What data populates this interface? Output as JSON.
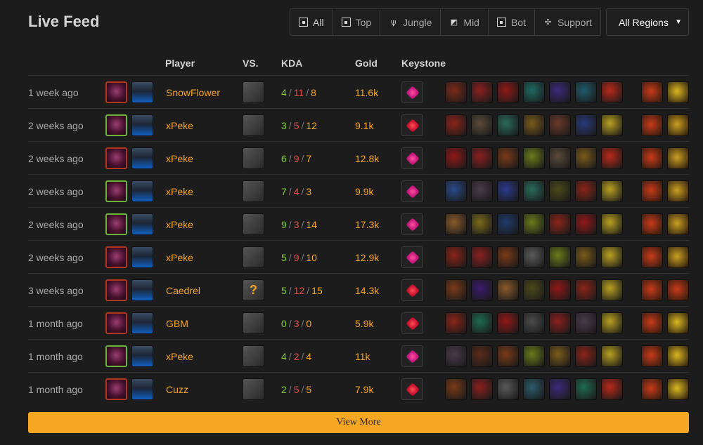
{
  "header": {
    "title": "Live Feed"
  },
  "filters": [
    {
      "label": "All",
      "icon": "all-role-icon",
      "glyph": ""
    },
    {
      "label": "Top",
      "icon": "top-role-icon",
      "glyph": ""
    },
    {
      "label": "Jungle",
      "icon": "jungle-role-icon",
      "glyph": "ѱ"
    },
    {
      "label": "Mid",
      "icon": "mid-role-icon",
      "glyph": "◩"
    },
    {
      "label": "Bot",
      "icon": "bot-role-icon",
      "glyph": ""
    },
    {
      "label": "Support",
      "icon": "support-role-icon",
      "glyph": "✣"
    }
  ],
  "region": {
    "selected": "All Regions"
  },
  "columns": {
    "player": "Player",
    "vs": "VS.",
    "kda": "KDA",
    "gold": "Gold",
    "keystone": "Keystone"
  },
  "colors": {
    "accent": "#f5a623",
    "kills": "#7ed321",
    "deaths": "#e84a4a",
    "loss_border": "#b0361f",
    "win_border": "#6cb33a"
  },
  "rows": [
    {
      "time": "1 week ago",
      "player": "SnowFlower",
      "result": "loss",
      "vs_icon": "opponent-champion-icon",
      "k": "4",
      "d": "11",
      "a": "8",
      "gold": "11.6k",
      "keystone": "pink",
      "items": [
        "#7a2a18",
        "#8a1f1f",
        "#901818",
        "#1f6a62",
        "#3a2a7a",
        "#1f5a6a",
        "#b8281a"
      ],
      "spells": [
        "#c83a1a",
        "#d8b820"
      ]
    },
    {
      "time": "2 weeks ago",
      "player": "xPeke",
      "result": "win",
      "vs_icon": "opponent-champion-icon",
      "k": "3",
      "d": "5",
      "a": "12",
      "gold": "9.1k",
      "keystone": "red",
      "items": [
        "#8a2418",
        "#5a4a3a",
        "#2a6a5a",
        "#7a5a1a",
        "#6a3a2a",
        "#2a3a7a",
        "#b8a020"
      ],
      "spells": [
        "#c83a1a",
        "#c8a020"
      ]
    },
    {
      "time": "2 weeks ago",
      "player": "xPeke",
      "result": "loss",
      "vs_icon": "opponent-champion-icon",
      "k": "6",
      "d": "9",
      "a": "7",
      "gold": "12.8k",
      "keystone": "pink",
      "items": [
        "#901818",
        "#8a1f1f",
        "#7a3a18",
        "#6a7a1a",
        "#5a4a3a",
        "#7a5a1a",
        "#b8281a"
      ],
      "spells": [
        "#c83a1a",
        "#c8a020"
      ]
    },
    {
      "time": "2 weeks ago",
      "player": "xPeke",
      "result": "win",
      "vs_icon": "opponent-champion-icon",
      "k": "7",
      "d": "4",
      "a": "3",
      "gold": "9.9k",
      "keystone": "pink",
      "items": [
        "#2a4a8a",
        "#4a3a4a",
        "#2a3a8a",
        "#2a6a5a",
        "#4a4a1a",
        "#8a2418",
        "#b8a020"
      ],
      "spells": [
        "#c83a1a",
        "#c8a020"
      ]
    },
    {
      "time": "2 weeks ago",
      "player": "xPeke",
      "result": "win",
      "vs_icon": "opponent-champion-icon",
      "k": "9",
      "d": "3",
      "a": "14",
      "gold": "17.3k",
      "keystone": "pink",
      "items": [
        "#8a5a2a",
        "#7a6a1a",
        "#1f3a6a",
        "#6a7a1a",
        "#8a2418",
        "#901818",
        "#b8a020"
      ],
      "spells": [
        "#c83a1a",
        "#c8a020"
      ]
    },
    {
      "time": "2 weeks ago",
      "player": "xPeke",
      "result": "loss",
      "vs_icon": "opponent-champion-icon",
      "k": "5",
      "d": "9",
      "a": "10",
      "gold": "12.9k",
      "keystone": "pink",
      "items": [
        "#8a2418",
        "#8a1f1f",
        "#7a3a18",
        "#5a5a5a",
        "#6a7a1a",
        "#7a5a1a",
        "#b8a020"
      ],
      "spells": [
        "#c83a1a",
        "#c8a020"
      ]
    },
    {
      "time": "3 weeks ago",
      "player": "Caedrel",
      "result": "loss",
      "vs_icon": "unknown-champion-icon",
      "vs_glyph": "?",
      "k": "5",
      "d": "12",
      "a": "15",
      "gold": "14.3k",
      "keystone": "red",
      "items": [
        "#7a3a18",
        "#3a1a6a",
        "#8a5a2a",
        "#4a4a1a",
        "#901818",
        "#8a2418",
        "#b8a020"
      ],
      "spells": [
        "#c83a1a",
        "#c83a1a"
      ]
    },
    {
      "time": "1 month ago",
      "player": "GBM",
      "result": "loss",
      "vs_icon": "opponent-champion-icon",
      "k": "0",
      "d": "3",
      "a": "0",
      "gold": "5.9k",
      "keystone": "red",
      "items": [
        "#8a2418",
        "#1f6a52",
        "#901818",
        "#4a4a4a",
        "#8a1f1f",
        "#4a3a4a",
        "#b8a020"
      ],
      "spells": [
        "#c83a1a",
        "#d8b820"
      ]
    },
    {
      "time": "1 month ago",
      "player": "xPeke",
      "result": "win",
      "vs_icon": "opponent-champion-icon",
      "k": "4",
      "d": "2",
      "a": "4",
      "gold": "11k",
      "keystone": "pink",
      "items": [
        "#4a3a4a",
        "#5a2a1a",
        "#7a3a18",
        "#6a7a1a",
        "#7a5a1a",
        "#8a2418",
        "#b8a020"
      ],
      "spells": [
        "#c83a1a",
        "#d8b820"
      ]
    },
    {
      "time": "1 month ago",
      "player": "Cuzz",
      "result": "loss",
      "vs_icon": "opponent-champion-icon",
      "k": "2",
      "d": "5",
      "a": "5",
      "gold": "7.9k",
      "keystone": "red",
      "items": [
        "#7a3a18",
        "#8a1f1f",
        "#5a5a5a",
        "#2a5a6a",
        "#3a2a7a",
        "#1f6a52",
        "#b8281a"
      ],
      "spells": [
        "#c83a1a",
        "#d8b820"
      ]
    }
  ],
  "footer": {
    "view_more": "View More"
  }
}
